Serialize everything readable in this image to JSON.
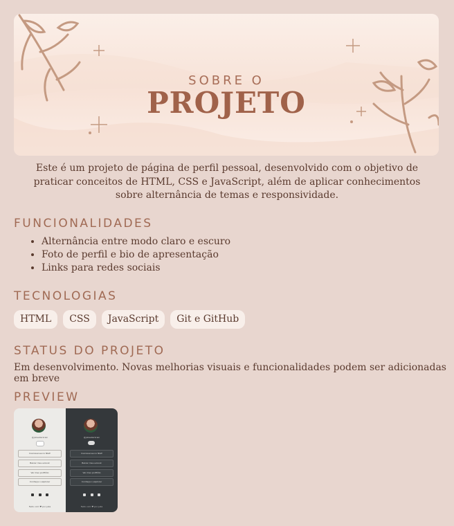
{
  "banner": {
    "subtitle": "SOBRE O",
    "title": "PROJETO"
  },
  "intro": "Este é um projeto de página de perfil pessoal, desenvolvido com o objetivo de praticar conceitos de HTML, CSS e JavaScript, além de aplicar conhecimentos sobre alternância de temas e responsividade.",
  "features": {
    "heading": "FUNCIONALIDADES",
    "items": [
      "Alternância entre modo claro e escuro",
      "Foto de perfil e bio de apresentação",
      "Links para redes sociais"
    ]
  },
  "technologies": {
    "heading": "TECNOLOGIAS",
    "tags": [
      "HTML",
      "CSS",
      "JavaScript",
      "Git e GitHub"
    ]
  },
  "status": {
    "heading": "STATUS DO PROJETO",
    "text": "Em desenvolvimento. Novas melhorias visuais e funcionalidades podem ser adicionadas em breve"
  },
  "preview": {
    "heading": "PREVIEW",
    "handle": "@Juliaellerbrain",
    "buttons": [
      "Inscrever-se no NLW",
      "Baixar meu e-book",
      "Ver meu portfólio",
      "Conheça o explorer"
    ],
    "footer": "Feito com ♥ por Julia"
  },
  "colors": {
    "background": "#e8d6cf",
    "heading": "#a06a54",
    "text": "#5a3a2e",
    "tag_bg": "#f8efea"
  }
}
